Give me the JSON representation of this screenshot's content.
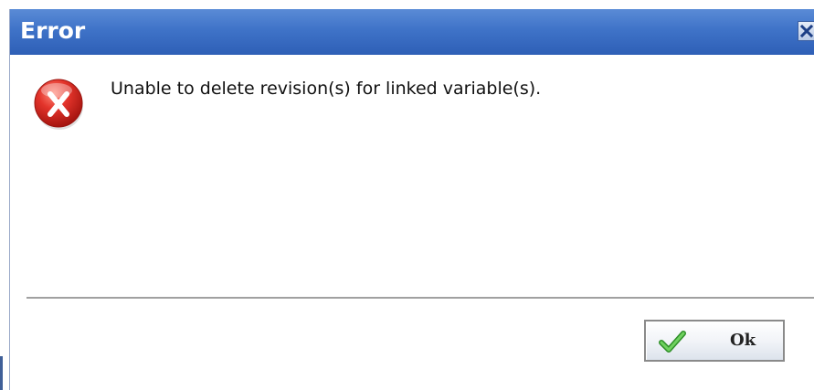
{
  "dialog": {
    "title": "Error",
    "message": "Unable to delete revision(s) for linked variable(s).",
    "ok_label": "Ok",
    "icons": {
      "close": "close-icon",
      "error": "error-icon",
      "ok": "checkmark-icon"
    },
    "colors": {
      "titlebar": "#3f73c8",
      "error_icon": "#d42a2a",
      "checkmark": "#3aa832"
    }
  }
}
